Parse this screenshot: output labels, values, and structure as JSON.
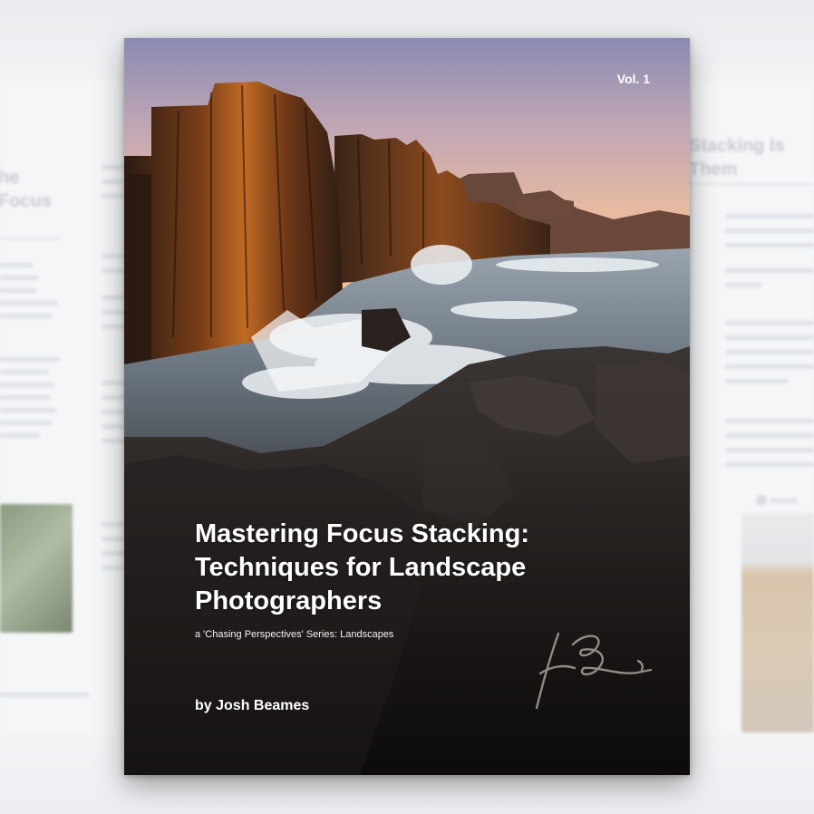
{
  "background": {
    "left_page": {
      "heading": "he\nFocus"
    },
    "right_page": {
      "heading": "Stacking Is\nThem"
    }
  },
  "cover": {
    "volume": "Vol. 1",
    "title": "Mastering Focus Stacking:\nTechniques for Landscape\nPhotographers",
    "subtitle": "a 'Chasing Perspectives' Series: Landscapes",
    "author": "by Josh Beames",
    "signature": "JB"
  }
}
